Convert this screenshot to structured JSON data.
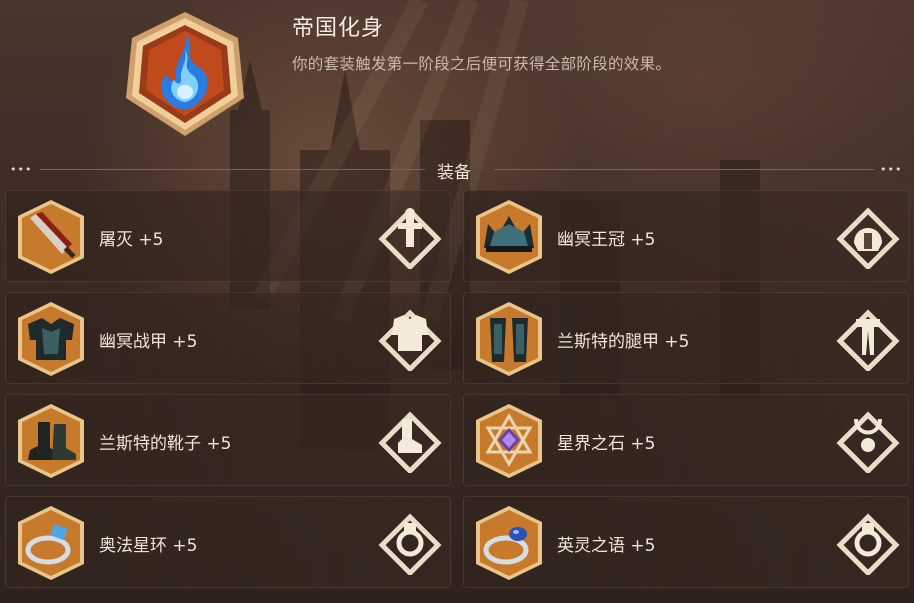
{
  "set": {
    "title": "帝国化身",
    "description": "你的套装触发第一阶段之后便可获得全部阶段的效果。",
    "emblem_icon": "blue-flame-icon"
  },
  "section": {
    "title": "装备",
    "dots": "•••"
  },
  "colors": {
    "frame_gold": "#d9b682",
    "icon_orange": "#c97b2c",
    "flame_blue": "#5ab8ff",
    "emblem_red": "#b63a17"
  },
  "items": [
    {
      "label": "屠灭 +5",
      "item_icon": "serrated-sword-icon",
      "slot_icon": "weapon-slot-icon"
    },
    {
      "label": "幽冥王冠 +5",
      "item_icon": "dark-crown-icon",
      "slot_icon": "helmet-slot-icon"
    },
    {
      "label": "幽冥战甲 +5",
      "item_icon": "dark-armor-icon",
      "slot_icon": "chest-slot-icon"
    },
    {
      "label": "兰斯特的腿甲 +5",
      "item_icon": "leg-armor-icon",
      "slot_icon": "legs-slot-icon"
    },
    {
      "label": "兰斯特的靴子 +5",
      "item_icon": "boots-icon",
      "slot_icon": "boots-slot-icon"
    },
    {
      "label": "星界之石 +5",
      "item_icon": "astral-stone-icon",
      "slot_icon": "amulet-slot-icon"
    },
    {
      "label": "奥法星环 +5",
      "item_icon": "arcane-ring-icon",
      "slot_icon": "ring-slot-icon"
    },
    {
      "label": "英灵之语 +5",
      "item_icon": "sapphire-ring-icon",
      "slot_icon": "ring-slot-icon"
    }
  ]
}
